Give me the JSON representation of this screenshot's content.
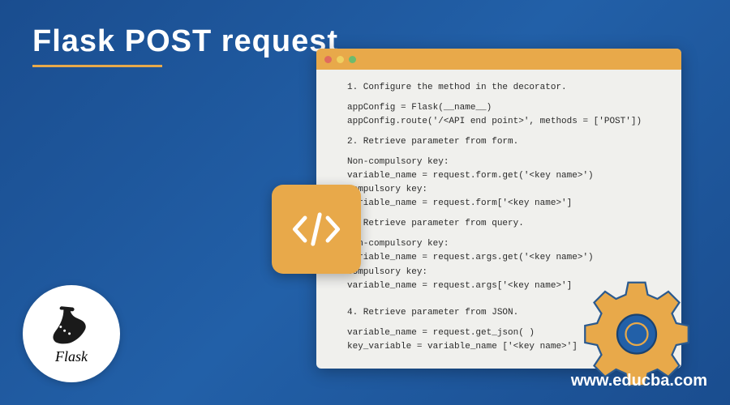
{
  "title": "Flask POST request",
  "window": {
    "section1_title": "1. Configure the method in the decorator.",
    "section1_line1": "appConfig = Flask(__name__)",
    "section1_line2": "appConfig.route('/<API end point>', methods = ['POST'])",
    "section2_title": "2. Retrieve parameter from form.",
    "section2_line1": "Non-compulsory key:",
    "section2_line2": "variable_name = request.form.get('<key name>')",
    "section2_line3": "Compulsory key:",
    "section2_line4": "variable_name = request.form['<key name>']",
    "section3_title": "3. Retrieve parameter from query.",
    "section3_line1": "Non-compulsory key:",
    "section3_line2": "variable_name = request.args.get('<key name>')",
    "section3_line3": "Compulsory key:",
    "section3_line4": "variable_name = request.args['<key name>']",
    "section4_title": "4. Retrieve parameter from JSON.",
    "section4_line1": "variable_name = request.get_json( )",
    "section4_line2": "key_variable = variable_name ['<key name>']"
  },
  "flask_label": "Flask",
  "website": "www.educba.com",
  "colors": {
    "accent": "#e8a94a",
    "bg_start": "#1a4d8f",
    "bg_end": "#2260a8"
  }
}
